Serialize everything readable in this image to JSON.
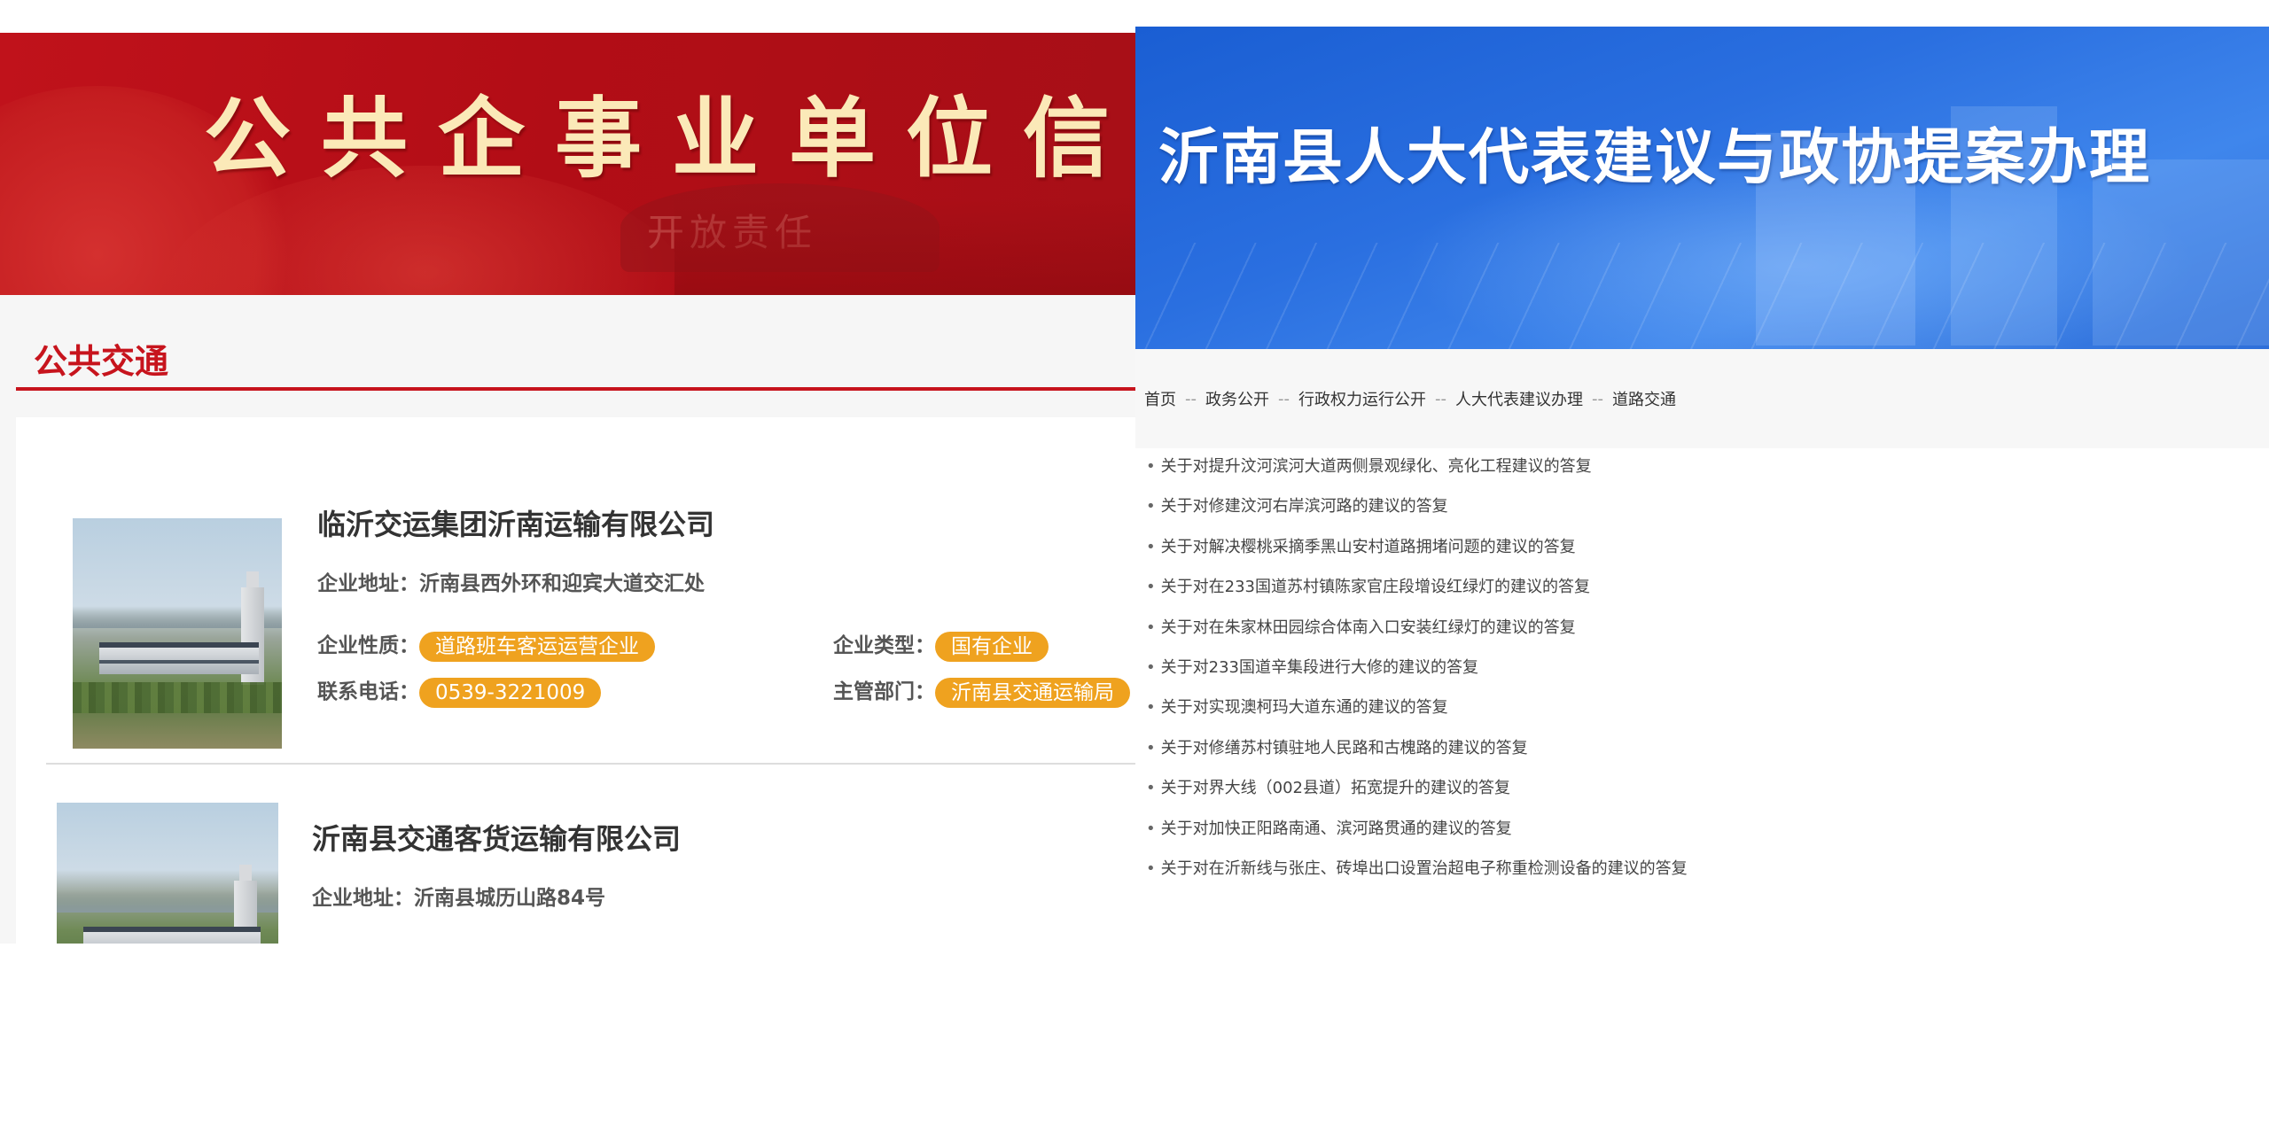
{
  "left_panel": {
    "banner_title": "公共企事业单位信息",
    "banner_stone_text": "开放责任",
    "section_title": "公共交通",
    "companies": [
      {
        "name": "临沂交运集团沂南运输有限公司",
        "address_label": "企业地址：",
        "address": "沂南县西外环和迎宾大道交汇处",
        "nature_label": "企业性质：",
        "nature": "道路班车客运运营企业",
        "type_label": "企业类型：",
        "type": "国有企业",
        "phone_label": "联系电话：",
        "phone": "0539-3221009",
        "dept_label": "主管部门：",
        "dept": "沂南县交通运输局"
      },
      {
        "name": "沂南县交通客货运输有限公司",
        "address_label": "企业地址：",
        "address": "沂南县城历山路84号"
      }
    ],
    "colors": {
      "accent_red": "#c7141d",
      "tag_orange": "#efa21f",
      "title_gold": "#fbe9b8"
    }
  },
  "right_panel": {
    "banner_title": "沂南县人大代表建议与政协提案办理",
    "breadcrumb": [
      "首页",
      "政务公开",
      "行政权力运行公开",
      "人大代表建议办理",
      "道路交通"
    ],
    "breadcrumb_separator": "--",
    "bullet": "•",
    "articles": [
      "关于对提升汶河滨河大道两侧景观绿化、亮化工程建议的答复",
      "关于对修建汶河右岸滨河路的建议的答复",
      "关于对解决樱桃采摘季黑山安村道路拥堵问题的建议的答复",
      "关于对在233国道苏村镇陈家官庄段增设红绿灯的建议的答复",
      "关于对在朱家林田园综合体南入口安装红绿灯的建议的答复",
      "关于对233国道辛集段进行大修的建议的答复",
      "关于对实现澳柯玛大道东通的建议的答复",
      "关于对修缮苏村镇驻地人民路和古槐路的建议的答复",
      "关于对界大线（002县道）拓宽提升的建议的答复",
      "关于对加快正阳路南通、滨河路贯通的建议的答复",
      "关于对在沂新线与张庄、砖埠出口设置治超电子称重检测设备的建议的答复"
    ],
    "colors": {
      "banner_blue": "#2a6fe0"
    }
  }
}
